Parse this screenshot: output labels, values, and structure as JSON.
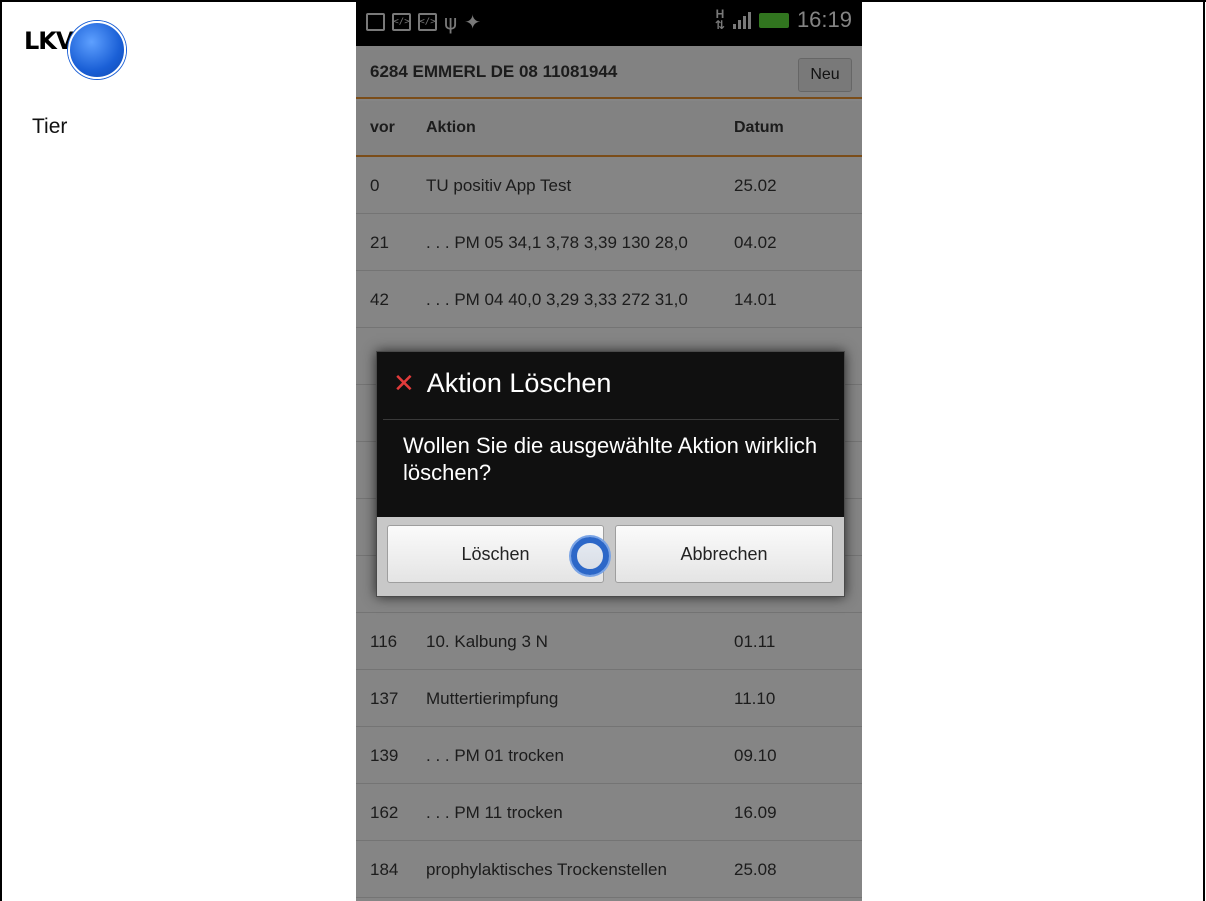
{
  "sidebar": {
    "tier_label": "Tier",
    "logo_text": "LKV"
  },
  "statusbar": {
    "network_label": "H",
    "time": "16:19"
  },
  "header": {
    "title": "6284 EMMERL DE 08 11081944",
    "new_button": "Neu"
  },
  "table": {
    "columns": [
      "vor",
      "Aktion",
      "Datum"
    ],
    "rows": [
      {
        "vor": "0",
        "aktion": "TU positiv App Test",
        "datum": "25.02"
      },
      {
        "vor": "21",
        "aktion": ". . . PM 05 34,1 3,78 3,39  130 28,0",
        "datum": "04.02"
      },
      {
        "vor": "42",
        "aktion": ". . . PM 04 40,0 3,29 3,33  272 31,0",
        "datum": "14.01"
      },
      {
        "vor": "",
        "aktion": "",
        "datum": ""
      },
      {
        "vor": "",
        "aktion": "",
        "datum": ""
      },
      {
        "vor": "",
        "aktion": "",
        "datum": ""
      },
      {
        "vor": "",
        "aktion": "",
        "datum": ""
      },
      {
        "vor": "",
        "aktion": "",
        "datum": ""
      },
      {
        "vor": "116",
        "aktion": "10. Kalbung 3 N",
        "datum": "01.11"
      },
      {
        "vor": "137",
        "aktion": "Muttertierimpfung",
        "datum": "11.10"
      },
      {
        "vor": "139",
        "aktion": ". . . PM 01  trocken",
        "datum": "09.10"
      },
      {
        "vor": "162",
        "aktion": ". . . PM 11  trocken",
        "datum": "16.09"
      },
      {
        "vor": "184",
        "aktion": "prophylaktisches Trockenstellen",
        "datum": "25.08"
      }
    ]
  },
  "dialog": {
    "title": "Aktion Löschen",
    "message": "Wollen Sie die ausgewählte Aktion wirklich löschen?",
    "confirm_label": "Löschen",
    "cancel_label": "Abbrechen"
  },
  "colors": {
    "accent": "#e08c2e",
    "dialog_bg": "#101010",
    "touch_ring": "#2c67c8",
    "delete_icon": "#e23b3b"
  },
  "icons": [
    "close-icon",
    "usb-icon",
    "signal-icon",
    "battery-icon",
    "touch-indicator"
  ]
}
